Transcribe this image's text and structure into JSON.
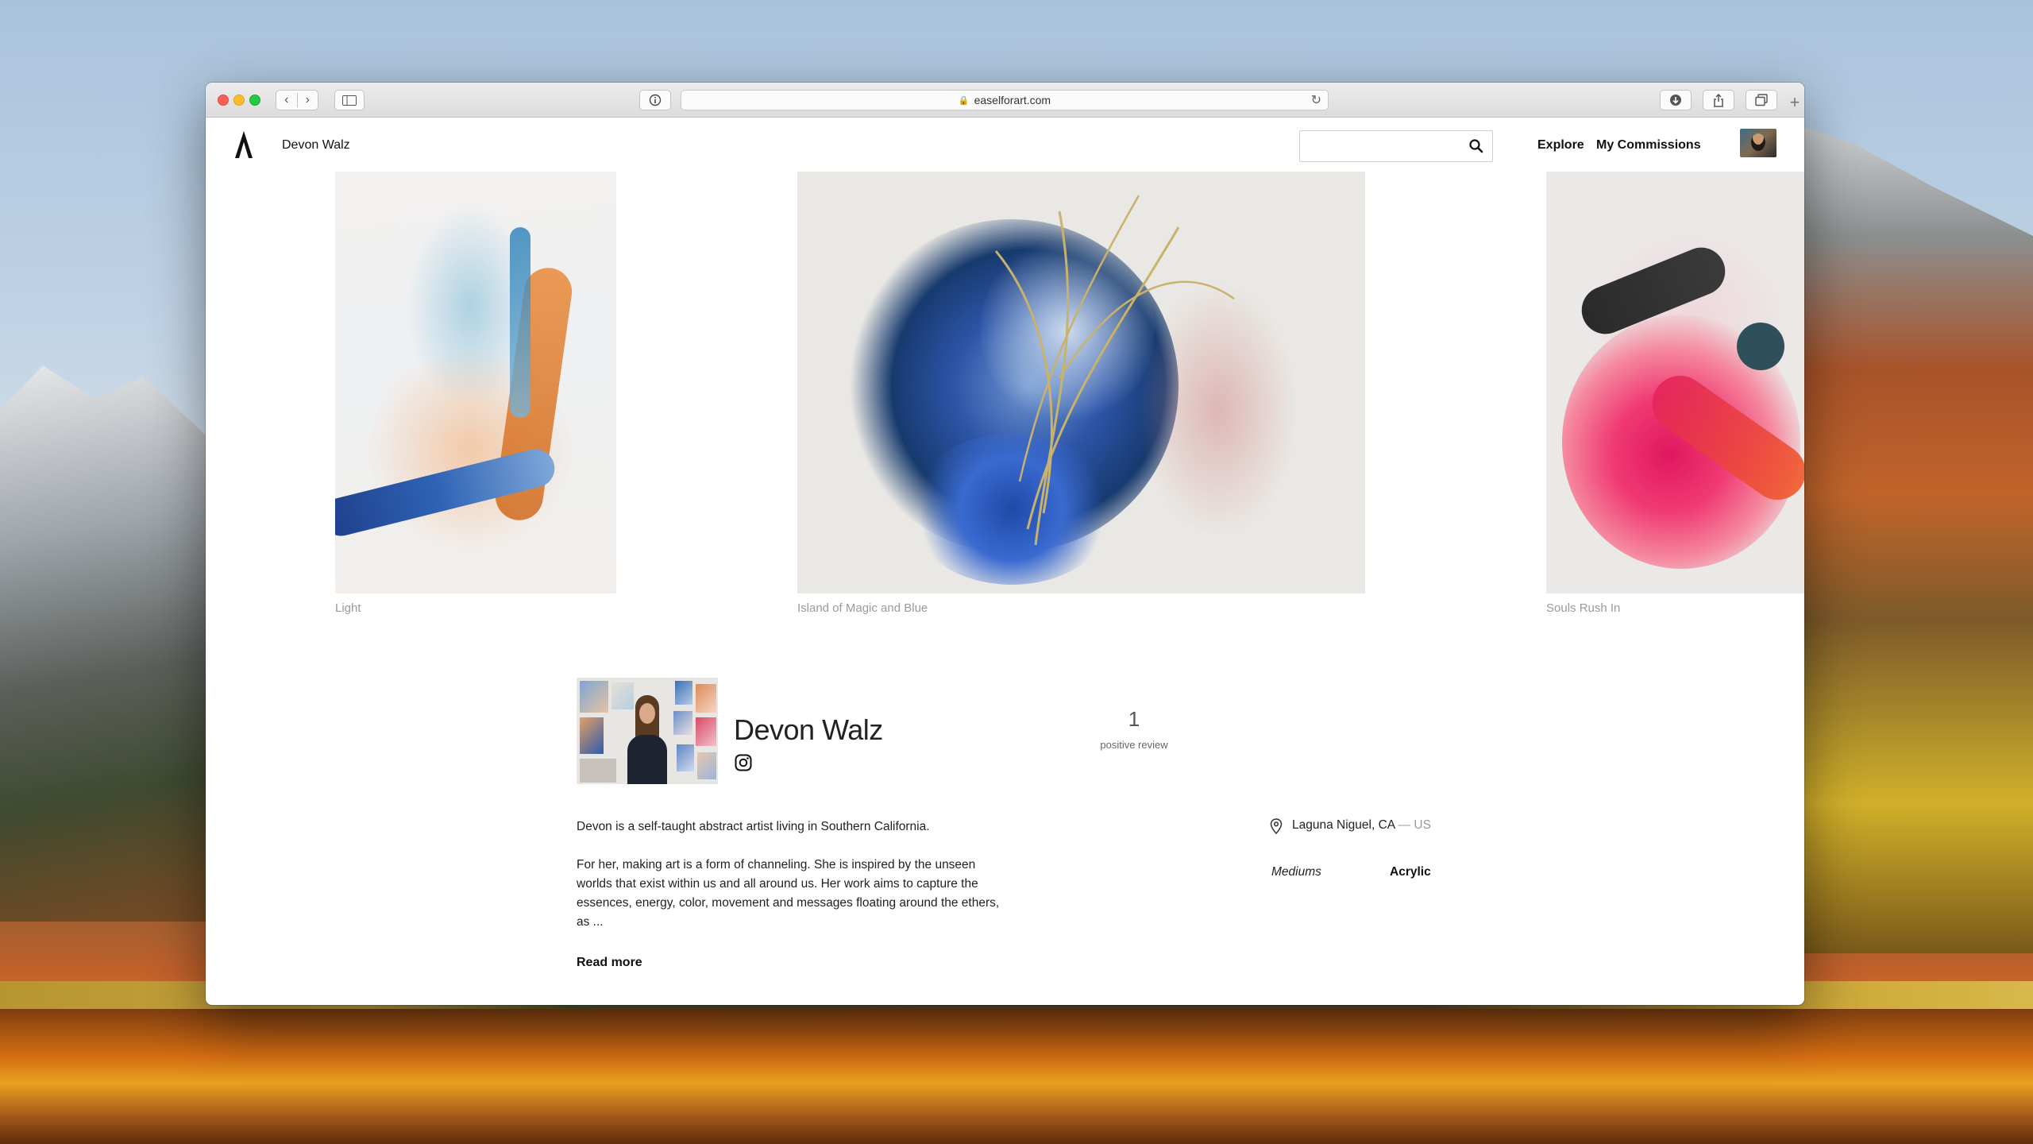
{
  "browser": {
    "url": "easelforart.com"
  },
  "site": {
    "header_name": "Devon Walz",
    "search_placeholder": "",
    "nav": {
      "explore": "Explore",
      "commissions": "My Commissions"
    }
  },
  "gallery": {
    "artworks": [
      {
        "title": "Light"
      },
      {
        "title": "Island of Magic and Blue"
      },
      {
        "title": "Souls Rush In"
      }
    ]
  },
  "artist": {
    "name": "Devon Walz",
    "review_count": "1",
    "review_label": "positive review",
    "bio_paragraph_1": "Devon is a self-taught abstract artist living in Southern California.",
    "bio_paragraph_2": "For her, making art is a form of channeling. She is inspired by the unseen worlds that exist within us and all around us. Her work aims to capture the essences, energy, color, movement and messages floating around the ethers, as ...",
    "read_more": "Read more",
    "location_city": "Laguna Niguel, CA",
    "location_country": "— US",
    "mediums_label": "Mediums",
    "mediums_value": "Acrylic"
  },
  "icons": {
    "logo": "easel-logo-icon",
    "search": "search-icon",
    "instagram": "instagram-icon",
    "location": "location-pin-icon"
  },
  "colors": {
    "text_primary": "#222222",
    "text_muted": "#9a9a9a",
    "traffic_close": "#fc5f57",
    "traffic_minimize": "#fdbc2e",
    "traffic_maximize": "#28c840"
  }
}
